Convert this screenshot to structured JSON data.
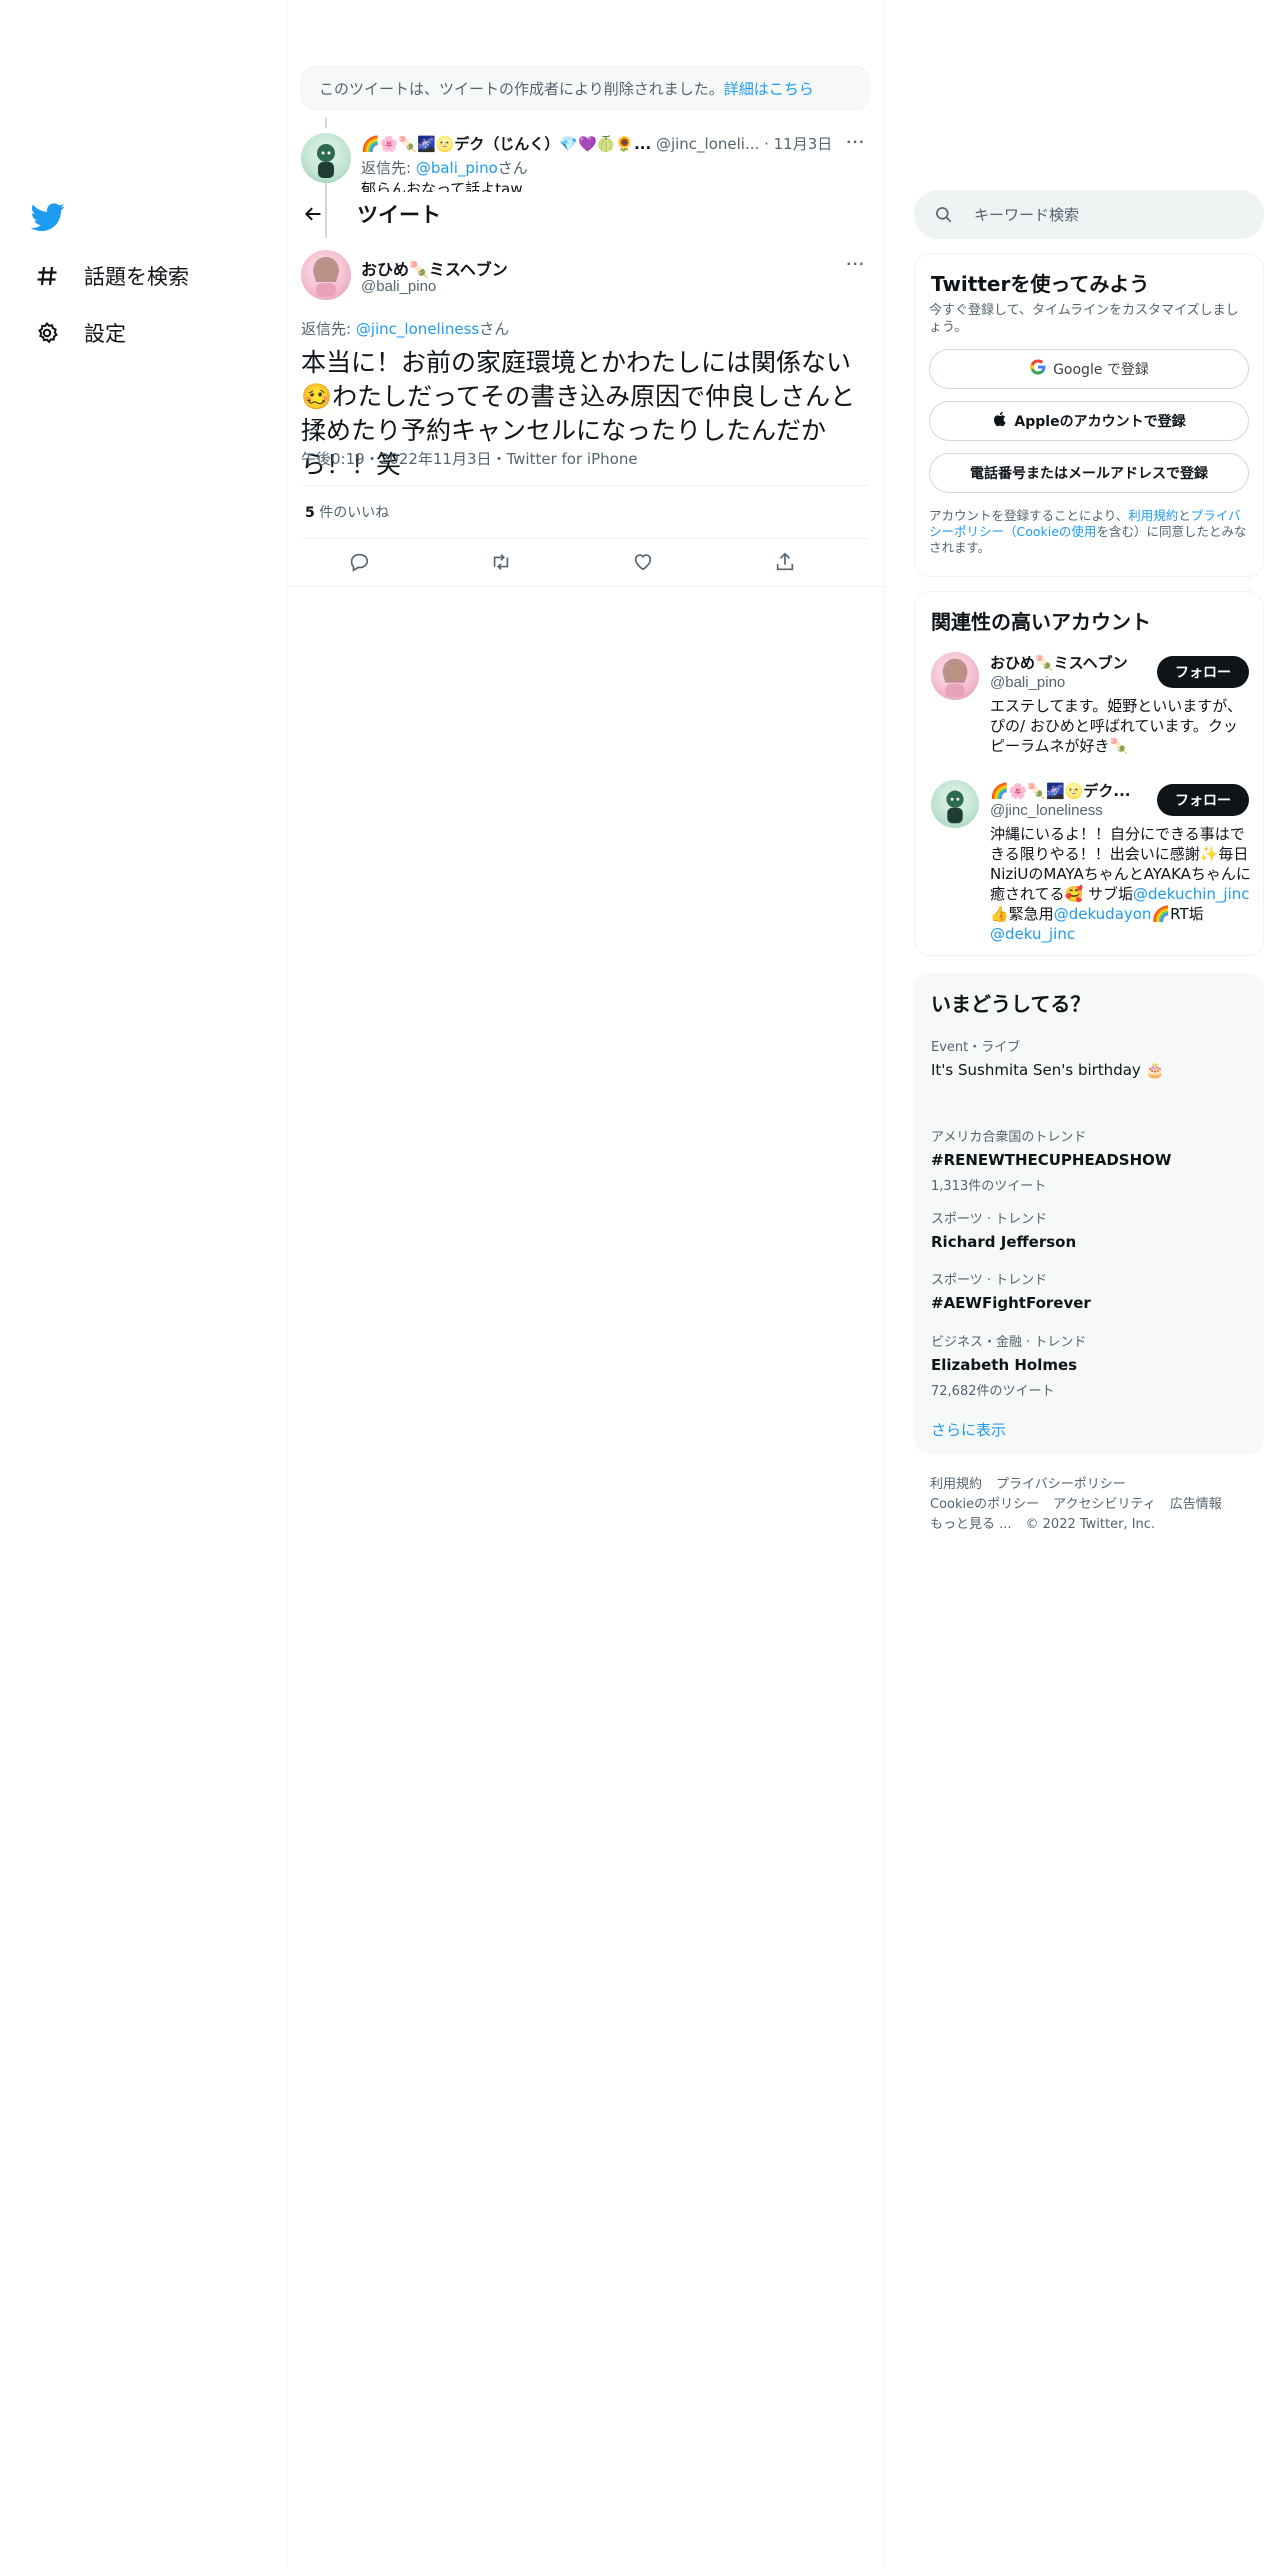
{
  "nav": {
    "items": [
      {
        "label": "話題を検索",
        "icon": "hashtag-icon"
      },
      {
        "label": "設定",
        "icon": "gear-icon"
      }
    ]
  },
  "deleted_notice": {
    "text": "このツイートは、ツイートの作成者により削除されました。",
    "link": "詳細はこちら"
  },
  "reply_tweet": {
    "name": "🌈🌸🍡🌌🌝デク（じんく）💎💜🍈🌻...",
    "handle": "@jinc_loneli...",
    "date": "11月3日",
    "replying_prefix": "返信先:",
    "replying_handle": "@bali_pino",
    "replying_suffix": "さん",
    "body": "郁らんおなって話よtaw"
  },
  "header": {
    "title": "ツイート"
  },
  "tweet": {
    "author_name": "おひめ🍡ミスヘブン",
    "author_handle": "@bali_pino",
    "replying_prefix": "返信先:",
    "replying_handle": "@jinc_loneliness",
    "replying_suffix": "さん",
    "text": "本当に！お前の家庭環境とかわたしには関係ない🥴わたしだってその書き込み原因で仲良しさんと揉めたり予約キャンセルになったりしたんだから！！笑",
    "meta": "午後0:19・2022年11月3日・Twitter for iPhone",
    "likes_count": "5",
    "likes_label": "件のいいね"
  },
  "search": {
    "placeholder": "キーワード検索"
  },
  "signup": {
    "title": "Twitterを使ってみよう",
    "subtitle": "今すぐ登録して、タイムラインをカスタマイズしましょう。",
    "google_label": "Google で登録",
    "apple_label": "Appleのアカウントで登録",
    "phone_label": "電話番号またはメールアドレスで登録",
    "legal_prefix": "アカウントを登録することにより、",
    "legal_terms": "利用規約",
    "legal_and": "と",
    "legal_privacy": "プライバシーポリシー（Cookieの使用",
    "legal_suffix": "を含む）に同意したとみなされます。"
  },
  "relevant": {
    "title": "関連性の高いアカウント",
    "follow_label": "フォロー",
    "accounts": [
      {
        "name": "おひめ🍡ミスヘブン",
        "handle": "@bali_pino",
        "bio": "エステしてます。姫野といいますが、ぴの/ おひめと呼ばれています。クッピーラムネが好き🍡"
      },
      {
        "name": "🌈🌸🍡🌌🌝デク...",
        "handle": "@jinc_loneliness",
        "bio_1": "沖縄にいるよ！！自分にできる事はできる限りやる！！出会いに感謝✨毎日NiziUのMAYAちゃんとAYAKAちゃんに癒されてる🥰 サブ垢",
        "bio_link1": "@dekuchin_jinc",
        "bio_2": "👍緊急用",
        "bio_link2": "@dekudayon",
        "bio_3": "🌈RT垢",
        "bio_link3": "@deku_jinc"
      }
    ]
  },
  "trends": {
    "title": "いまどうしてる？",
    "items": [
      {
        "category": "Event・ライブ",
        "title": "It's Sushmita Sen's birthday 🎂",
        "count": ""
      },
      {
        "category": "アメリカ合衆国のトレンド",
        "title": "#RENEWTHECUPHEADSHOW",
        "count": "1,313件のツイート"
      },
      {
        "category": "スポーツ · トレンド",
        "title": "Richard Jefferson",
        "count": ""
      },
      {
        "category": "スポーツ · トレンド",
        "title": "#AEWFightForever",
        "count": ""
      },
      {
        "category": "ビジネス・金融 · トレンド",
        "title": "Elizabeth Holmes",
        "count": "72,682件のツイート"
      }
    ],
    "show_more": "さらに表示"
  },
  "footer": {
    "terms": "利用規約",
    "privacy": "プライバシーポリシー",
    "cookie": "Cookieのポリシー",
    "accessibility": "アクセシビリティ",
    "ads": "広告情報",
    "more": "もっと見る ...",
    "copyright": "© 2022 Twitter, Inc."
  },
  "colors": {
    "accent": "#1d9bf0",
    "text": "#0f1419",
    "muted": "#536471",
    "border": "#eff3f4"
  }
}
